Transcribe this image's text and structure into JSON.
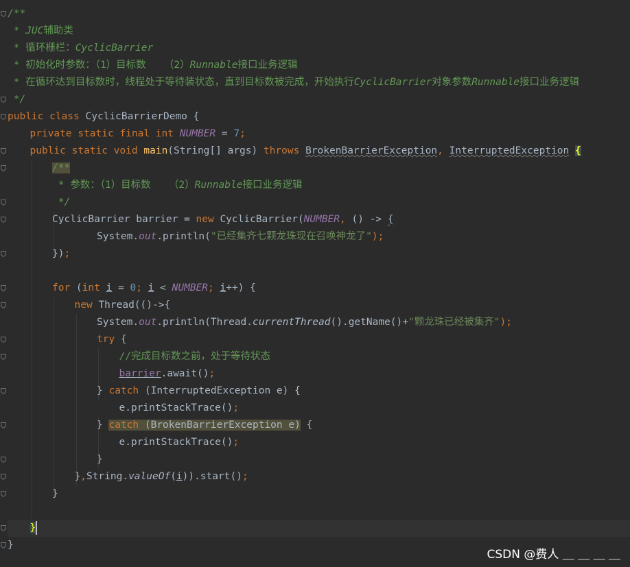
{
  "editor": {
    "language": "java",
    "lines": [
      {
        "indent": 0,
        "tokens": [
          {
            "t": "/**",
            "c": "comment"
          }
        ]
      },
      {
        "indent": 0,
        "tokens": [
          {
            "t": " * ",
            "c": "comment"
          },
          {
            "t": "JUC",
            "c": "comment"
          },
          {
            "t": "辅助类",
            "c": "commentcn"
          }
        ]
      },
      {
        "indent": 0,
        "tokens": [
          {
            "t": " * ",
            "c": "comment"
          },
          {
            "t": "循环栅栏：",
            "c": "commentcn"
          },
          {
            "t": "CyclicBarrier",
            "c": "comment"
          }
        ]
      },
      {
        "indent": 0,
        "tokens": [
          {
            "t": " * ",
            "c": "comment"
          },
          {
            "t": "初始化时参数：（1）目标数   （2）",
            "c": "commentcn"
          },
          {
            "t": "Runnable",
            "c": "comment"
          },
          {
            "t": "接口业务逻辑",
            "c": "commentcn"
          }
        ]
      },
      {
        "indent": 0,
        "tokens": [
          {
            "t": " * ",
            "c": "comment"
          },
          {
            "t": "在循环达到目标数时，线程处于等待装状态，直到目标数被完成，开始执行",
            "c": "commentcn"
          },
          {
            "t": "CyclicBarrier",
            "c": "comment"
          },
          {
            "t": "对象参数",
            "c": "commentcn"
          },
          {
            "t": "Runnable",
            "c": "comment"
          },
          {
            "t": "接口业务逻辑",
            "c": "commentcn"
          }
        ]
      },
      {
        "indent": 0,
        "tokens": [
          {
            "t": " */",
            "c": "comment"
          }
        ]
      },
      {
        "indent": 0,
        "tokens": [
          {
            "t": "public class ",
            "c": "kw"
          },
          {
            "t": "CyclicBarrierDemo {",
            "c": ""
          }
        ]
      },
      {
        "indent": 1,
        "tokens": [
          {
            "t": "private static final int ",
            "c": "kw"
          },
          {
            "t": "NUMBER",
            "c": "const"
          },
          {
            "t": " = ",
            "c": ""
          },
          {
            "t": "7",
            "c": "num"
          },
          {
            "t": ";",
            "c": "kw"
          }
        ]
      },
      {
        "indent": 1,
        "tokens": [
          {
            "t": "public static void ",
            "c": "kw"
          },
          {
            "t": "main",
            "c": "fn"
          },
          {
            "t": "(String[] args) ",
            "c": ""
          },
          {
            "t": "throws ",
            "c": "kw"
          },
          {
            "t": "BrokenBarrierException",
            "c": "warn"
          },
          {
            "t": ", ",
            "c": "kw"
          },
          {
            "t": "InterruptedException",
            "c": "warn"
          },
          {
            "t": " ",
            "c": ""
          },
          {
            "t": "{",
            "c": "brace-hl"
          }
        ]
      },
      {
        "indent": 2,
        "tokens": [
          {
            "t": "/**",
            "c": "comment catch-hl"
          }
        ]
      },
      {
        "indent": 2,
        "tokens": [
          {
            "t": " * ",
            "c": "comment"
          },
          {
            "t": "参数：（1）目标数   （2）",
            "c": "commentcn"
          },
          {
            "t": "Runnable",
            "c": "comment"
          },
          {
            "t": "接口业务逻辑",
            "c": "commentcn"
          }
        ]
      },
      {
        "indent": 2,
        "tokens": [
          {
            "t": " */",
            "c": "comment"
          }
        ]
      },
      {
        "indent": 2,
        "tokens": [
          {
            "t": "CyclicBarrier barrier = ",
            "c": ""
          },
          {
            "t": "new ",
            "c": "kw"
          },
          {
            "t": "CyclicBarrier(",
            "c": ""
          },
          {
            "t": "NUMBER",
            "c": "const"
          },
          {
            "t": ", ",
            "c": "kw"
          },
          {
            "t": "() -> ",
            "c": ""
          },
          {
            "t": "{",
            "c": "warn"
          }
        ]
      },
      {
        "indent": 4,
        "tokens": [
          {
            "t": "System.",
            "c": ""
          },
          {
            "t": "out",
            "c": "field"
          },
          {
            "t": ".println(",
            "c": ""
          },
          {
            "t": "\"已经集齐七颗龙珠现在召唤神龙了\"",
            "c": "str"
          },
          {
            "t": ");",
            "c": "kw"
          }
        ]
      },
      {
        "indent": 2,
        "tokens": [
          {
            "t": "})",
            "c": ""
          },
          {
            "t": ";",
            "c": "kw"
          }
        ]
      },
      {
        "indent": 0,
        "tokens": []
      },
      {
        "indent": 2,
        "tokens": [
          {
            "t": "for ",
            "c": "kw"
          },
          {
            "t": "(",
            "c": ""
          },
          {
            "t": "int ",
            "c": "kw"
          },
          {
            "t": "i",
            "c": "underline"
          },
          {
            "t": " = ",
            "c": ""
          },
          {
            "t": "0",
            "c": "num"
          },
          {
            "t": "; ",
            "c": "kw"
          },
          {
            "t": "i",
            "c": "underline"
          },
          {
            "t": " < ",
            "c": ""
          },
          {
            "t": "NUMBER",
            "c": "const"
          },
          {
            "t": "; ",
            "c": "kw"
          },
          {
            "t": "i",
            "c": "underline"
          },
          {
            "t": "++) {",
            "c": ""
          }
        ]
      },
      {
        "indent": 3,
        "tokens": [
          {
            "t": "new ",
            "c": "kw"
          },
          {
            "t": "Thread(()->{",
            "c": ""
          }
        ]
      },
      {
        "indent": 4,
        "tokens": [
          {
            "t": "System.",
            "c": ""
          },
          {
            "t": "out",
            "c": "field"
          },
          {
            "t": ".println(Thread.",
            "c": ""
          },
          {
            "t": "currentThread",
            "c": "static"
          },
          {
            "t": "().getName()+",
            "c": ""
          },
          {
            "t": "\"颗龙珠已经被集齐\"",
            "c": "str"
          },
          {
            "t": ");",
            "c": "kw"
          }
        ]
      },
      {
        "indent": 4,
        "tokens": [
          {
            "t": "try ",
            "c": "kw"
          },
          {
            "t": "{",
            "c": ""
          }
        ]
      },
      {
        "indent": 5,
        "tokens": [
          {
            "t": "//完成目标数之前，处于等待状态",
            "c": "commentcn"
          }
        ]
      },
      {
        "indent": 5,
        "tokens": [
          {
            "t": "barrier",
            "c": "var underline"
          },
          {
            "t": ".await()",
            "c": ""
          },
          {
            "t": ";",
            "c": "kw"
          }
        ]
      },
      {
        "indent": 4,
        "tokens": [
          {
            "t": "} ",
            "c": ""
          },
          {
            "t": "catch ",
            "c": "kw"
          },
          {
            "t": "(InterruptedException e) {",
            "c": ""
          }
        ]
      },
      {
        "indent": 5,
        "tokens": [
          {
            "t": "e.printStackTrace()",
            "c": ""
          },
          {
            "t": ";",
            "c": "kw"
          }
        ]
      },
      {
        "indent": 4,
        "tokens": [
          {
            "t": "} ",
            "c": ""
          },
          {
            "t": "catch (BrokenBarrierException e)",
            "c": "catchblock"
          },
          {
            "t": " {",
            "c": ""
          }
        ]
      },
      {
        "indent": 5,
        "tokens": [
          {
            "t": "e.printStackTrace()",
            "c": ""
          },
          {
            "t": ";",
            "c": "kw"
          }
        ]
      },
      {
        "indent": 4,
        "tokens": [
          {
            "t": "}",
            "c": ""
          }
        ]
      },
      {
        "indent": 3,
        "tokens": [
          {
            "t": "}",
            "c": ""
          },
          {
            "t": ",",
            "c": "kw"
          },
          {
            "t": "String.",
            "c": ""
          },
          {
            "t": "valueOf",
            "c": "static"
          },
          {
            "t": "(",
            "c": ""
          },
          {
            "t": "i",
            "c": "underline"
          },
          {
            "t": ")).start()",
            "c": ""
          },
          {
            "t": ";",
            "c": "kw"
          }
        ]
      },
      {
        "indent": 2,
        "tokens": [
          {
            "t": "}",
            "c": ""
          }
        ]
      },
      {
        "indent": 0,
        "tokens": []
      },
      {
        "indent": 1,
        "tokens": [
          {
            "t": "}",
            "c": "cursor-brace"
          }
        ],
        "caret": true
      },
      {
        "indent": 0,
        "tokens": [
          {
            "t": "}",
            "c": ""
          }
        ]
      }
    ]
  },
  "watermark": {
    "text": "CSDN @费人 ＿ ＿ ＿ ＿"
  },
  "colors": {
    "background": "#2b2b2b",
    "keyword": "#cc7832",
    "comment": "#629755",
    "string": "#6a8759",
    "number": "#6897bb",
    "constant": "#9876aa",
    "function": "#ffc66d",
    "text": "#a9b7c6"
  }
}
